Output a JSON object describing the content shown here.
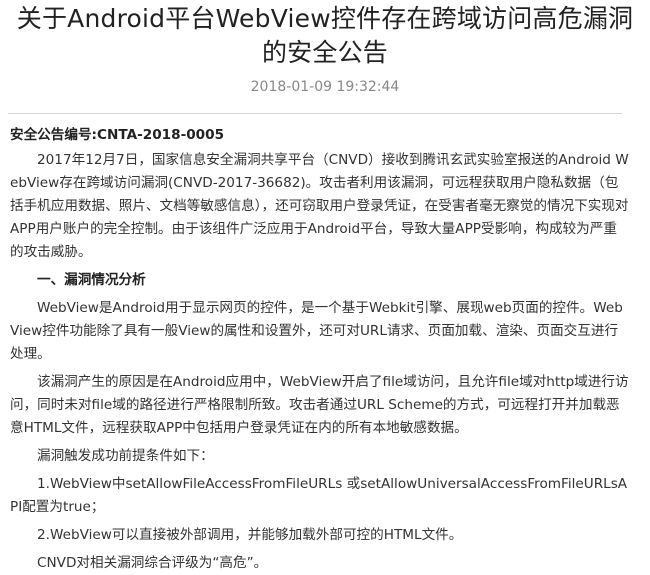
{
  "article": {
    "title_line1": "关于Android平台WebView控件存在跨域访问高危漏洞",
    "title_line2": "的安全公告",
    "date": "2018-01-09 19:32:44",
    "bulletin_no": "安全公告编号:CNTA-2018-0005",
    "p1": "2017年12月7日，国家信息安全漏洞共享平台（CNVD）接收到腾讯玄武实验室报送的Android WebView存在跨域访问漏洞(CNVD-2017-36682)。攻击者利用该漏洞，可远程获取用户隐私数据（包括手机应用数据、照片、文档等敏感信息），还可窃取用户登录凭证，在受害者毫无察觉的情况下实现对APP用户账户的完全控制。由于该组件广泛应用于Android平台，导致大量APP受影响，构成较为严重的攻击威胁。",
    "section1": "一、漏洞情况分析",
    "p2": "WebView是Android用于显示网页的控件，是一个基于Webkit引擎、展现web页面的控件。WebView控件功能除了具有一般View的属性和设置外，还可对URL请求、页面加载、渲染、页面交互进行处理。",
    "p3": "该漏洞产生的原因是在Android应用中，WebView开启了file域访问，且允许file域对http域进行访问，同时未对file域的路径进行严格限制所致。攻击者通过URL Scheme的方式，可远程打开并加载恶意HTML文件，远程获取APP中包括用户登录凭证在内的所有本地敏感数据。",
    "p4": "漏洞触发成功前提条件如下：",
    "p5": "1.WebView中setAllowFileAccessFromFileURLs 或setAllowUniversalAccessFromFileURLsAPI配置为true；",
    "p6": "2.WebView可以直接被外部调用，并能够加载外部可控的HTML文件。",
    "p7": "CNVD对相关漏洞综合评级为“高危”。"
  }
}
